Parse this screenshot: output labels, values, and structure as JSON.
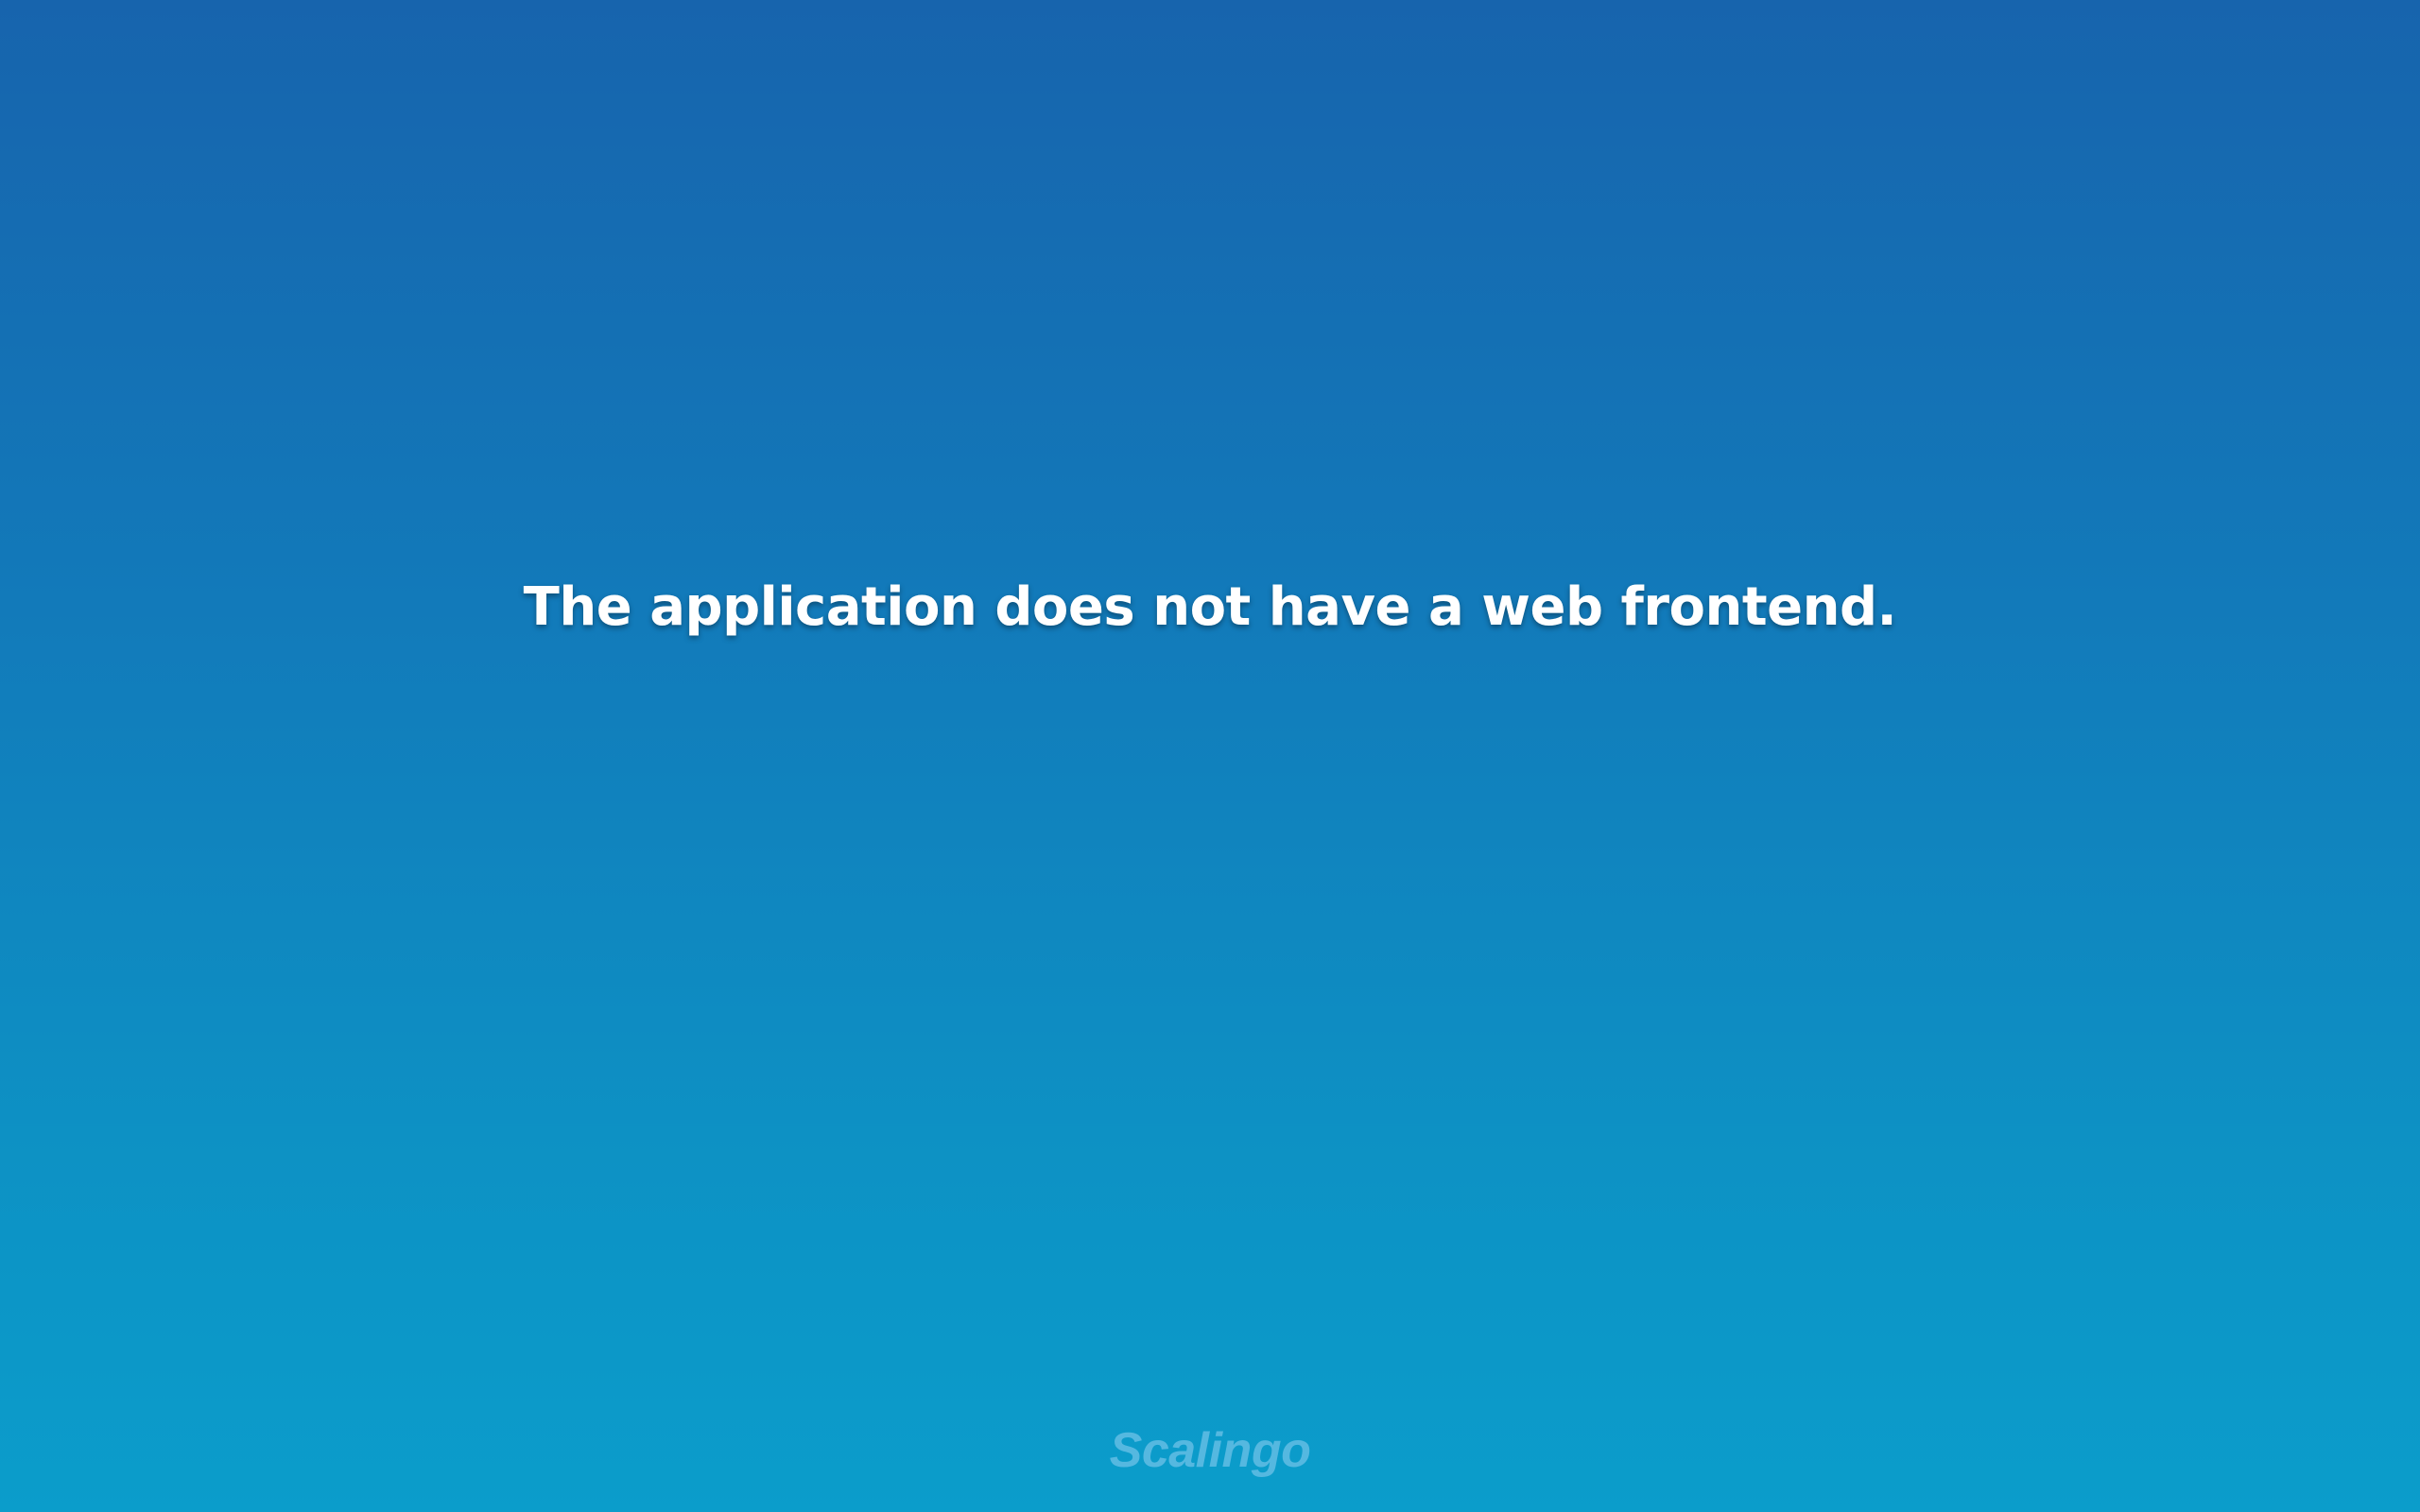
{
  "page": {
    "message": "The application does not have a web frontend.",
    "brand": "Scalingo"
  },
  "colors": {
    "background_top": "#1764ad",
    "background_bottom": "#0b9dcb",
    "message_text": "#ffffff",
    "brand_text": "#55b8e0"
  }
}
